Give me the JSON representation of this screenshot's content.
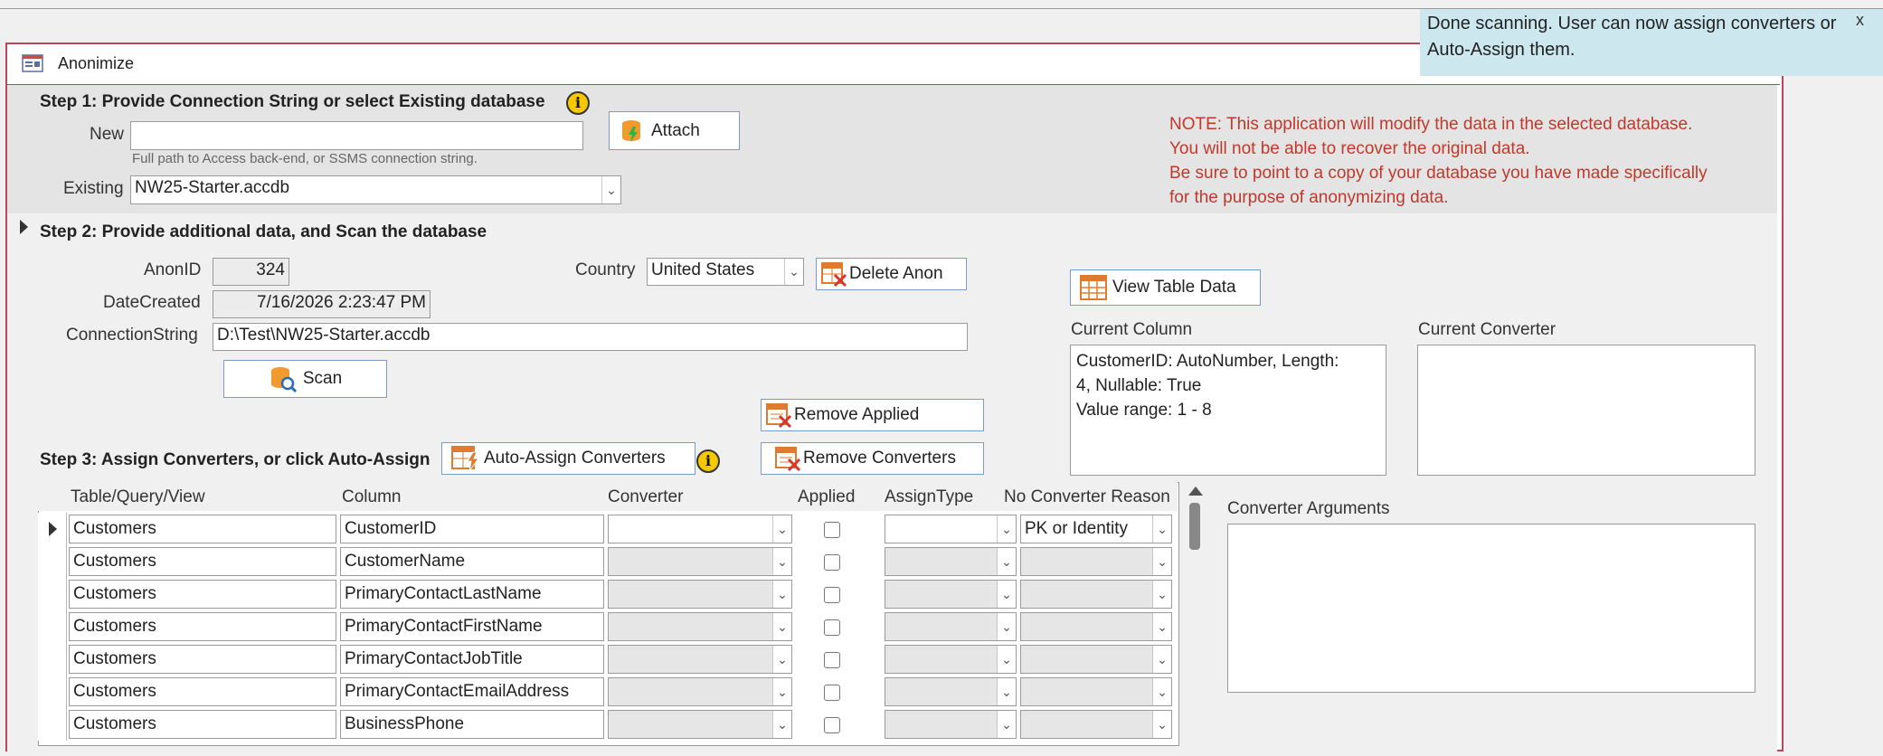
{
  "toast": {
    "message": "Done scanning. User can now assign converters or Auto-Assign them.",
    "close": "x"
  },
  "window": {
    "title": "Anonimize"
  },
  "step1": {
    "heading": "Step 1: Provide Connection String or select Existing database",
    "info_glyph": "i",
    "new_label": "New",
    "new_value": "",
    "hint": "Full path to Access back-end, or SSMS connection string.",
    "attach_label": "Attach",
    "existing_label": "Existing",
    "existing_value": "NW25-Starter.accdb",
    "note_lines": [
      "NOTE: This application will modify the data in the selected database.",
      "You will not be able to recover the original data.",
      "Be sure to point to a copy of your database you have made specifically",
      "for the purpose of anonymizing data."
    ]
  },
  "step2": {
    "heading": "Step 2: Provide additional data, and Scan the database",
    "anonid_label": "AnonID",
    "anonid_value": "324",
    "datecreated_label": "DateCreated",
    "datecreated_value": "7/16/2026 2:23:47 PM",
    "connstr_label": "ConnectionString",
    "connstr_value": "D:\\Test\\NW25-Starter.accdb",
    "country_label": "Country",
    "country_value": "United States",
    "delete_label": "Delete Anon",
    "scan_label": "Scan",
    "view_label": "View Table Data",
    "current_column_label": "Current Column",
    "current_column_lines": [
      "CustomerID: AutoNumber, Length:",
      "4, Nullable: True",
      "Value range: 1 - 8"
    ],
    "current_converter_label": "Current Converter",
    "current_converter_value": ""
  },
  "step3": {
    "heading": "Step 3: Assign Converters, or click Auto-Assign",
    "auto_assign_label": "Auto-Assign Converters",
    "remove_applied_label": "Remove Applied",
    "remove_converters_label": "Remove Converters",
    "converter_args_label": "Converter Arguments",
    "converter_args_value": "",
    "columns": [
      "Table/Query/View",
      "Column",
      "Converter",
      "Applied",
      "AssignType",
      "No Converter Reason"
    ],
    "rows": [
      {
        "table": "Customers",
        "column": "CustomerID",
        "converter": "",
        "applied": false,
        "assign": "",
        "reason": "PK or Identity"
      },
      {
        "table": "Customers",
        "column": "CustomerName",
        "converter": "",
        "applied": false,
        "assign": "",
        "reason": ""
      },
      {
        "table": "Customers",
        "column": "PrimaryContactLastName",
        "converter": "",
        "applied": false,
        "assign": "",
        "reason": ""
      },
      {
        "table": "Customers",
        "column": "PrimaryContactFirstName",
        "converter": "",
        "applied": false,
        "assign": "",
        "reason": ""
      },
      {
        "table": "Customers",
        "column": "PrimaryContactJobTitle",
        "converter": "",
        "applied": false,
        "assign": "",
        "reason": ""
      },
      {
        "table": "Customers",
        "column": "PrimaryContactEmailAddress",
        "converter": "",
        "applied": false,
        "assign": "",
        "reason": ""
      },
      {
        "table": "Customers",
        "column": "BusinessPhone",
        "converter": "",
        "applied": false,
        "assign": "",
        "reason": ""
      }
    ]
  },
  "colors": {
    "accent_border": "#b8475a",
    "note_red": "#c0392b",
    "toast_bg": "#cde7ef",
    "button_border": "#7a9cc6"
  }
}
